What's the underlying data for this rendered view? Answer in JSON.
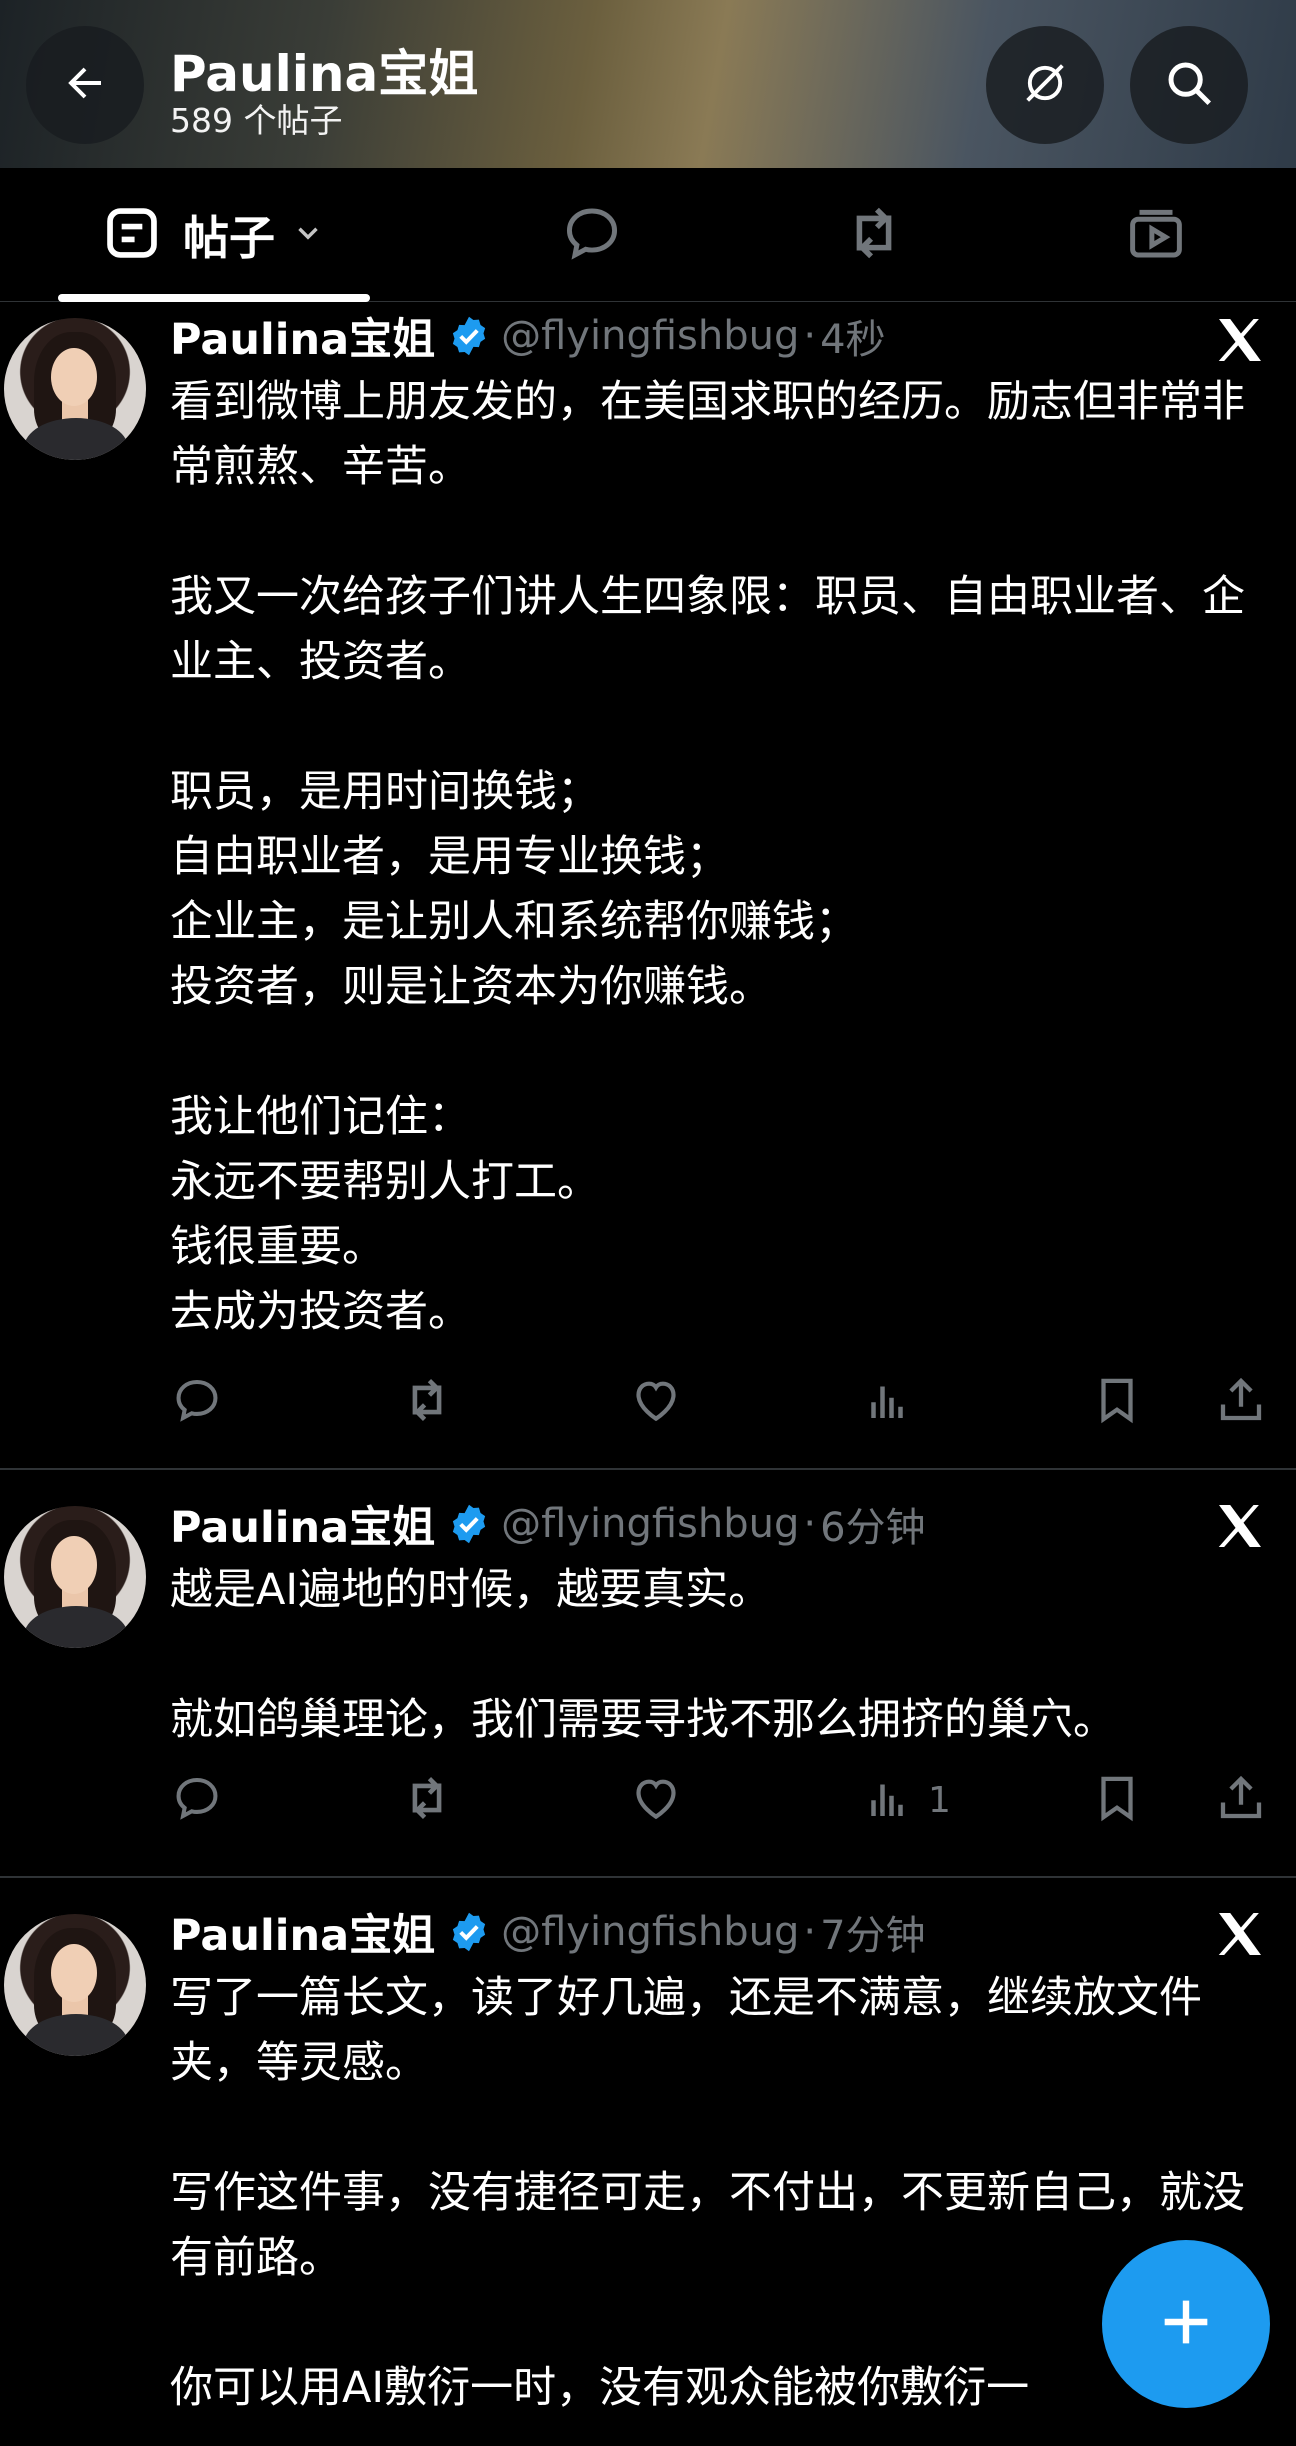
{
  "header": {
    "title": "Paulina宝姐",
    "subtitle": "589 个帖子"
  },
  "tabs": [
    {
      "label": "帖子",
      "icon": "posts-icon"
    },
    {
      "icon": "replies-icon"
    },
    {
      "icon": "reposts-icon"
    },
    {
      "icon": "media-icon"
    }
  ],
  "tweets": [
    {
      "name": "Paulina宝姐",
      "handle": "@flyingfishbug",
      "time": "4秒",
      "text": "看到微博上朋友发的，在美国求职的经历。励志但非常非常煎熬、辛苦。\n\n我又一次给孩子们讲人生四象限：职员、自由职业者、企业主、投资者。\n\n职员，是用时间换钱；\n自由职业者，是用专业换钱；\n企业主，是让别人和系统帮你赚钱；\n投资者，则是让资本为你赚钱。\n\n我让他们记住：\n永远不要帮别人打工。\n钱很重要。\n去成为投资者。",
      "views": ""
    },
    {
      "name": "Paulina宝姐",
      "handle": "@flyingfishbug",
      "time": "6分钟",
      "text": "越是AI遍地的时候，越要真实。\n\n就如鸽巢理论，我们需要寻找不那么拥挤的巢穴。",
      "views": "1"
    },
    {
      "name": "Paulina宝姐",
      "handle": "@flyingfishbug",
      "time": "7分钟",
      "text": "写了一篇长文，读了好几遍，还是不满意，继续放文件夹，等灵感。\n\n写作这件事，没有捷径可走，不付出，不更新自己，就没有前路。\n\n你可以用AI敷衍一时，没有观众能被你敷衍一",
      "views": ""
    }
  ],
  "colors": {
    "accent": "#1d9bf0",
    "muted": "#71767b",
    "divider": "#2f3336",
    "background": "#000000"
  }
}
